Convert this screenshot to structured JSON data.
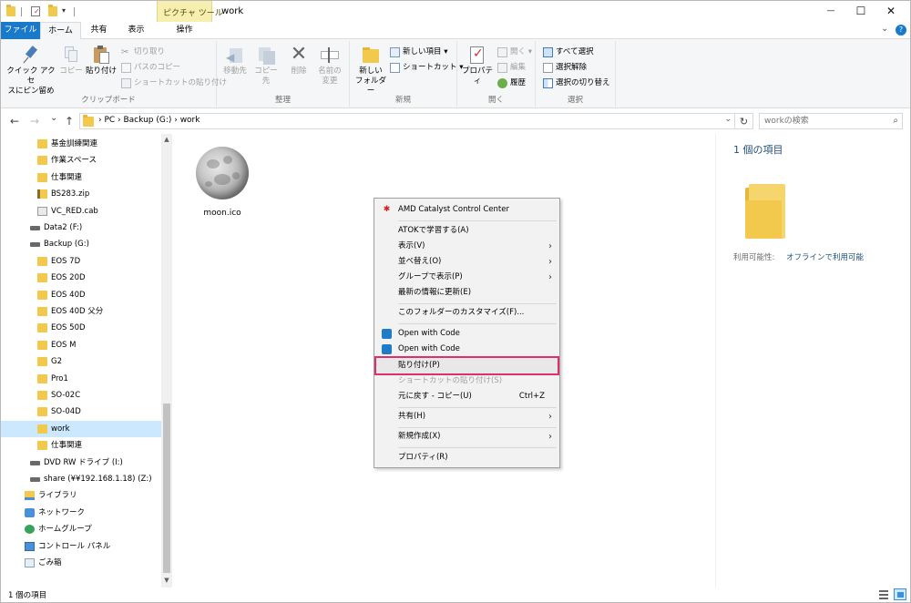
{
  "titlebar": {
    "contextual_tab": "ピクチャ ツール",
    "title": "work",
    "minimize": "—",
    "maximize": "☐",
    "close": "✕"
  },
  "ribbon_tabs": {
    "file": "ファイル",
    "home": "ホーム",
    "share": "共有",
    "view": "表示",
    "manage": "操作",
    "collapse": "⌄",
    "help": "?"
  },
  "ribbon": {
    "clipboard": {
      "label": "クリップボード",
      "pin": "クイック アクセス\nにピン留め",
      "pin_l1": "クイック アクセ",
      "pin_l2": "スにピン留め",
      "copy": "コピー",
      "paste": "貼り付け",
      "cut": "切り取り",
      "copy_path": "パスのコピー",
      "paste_shortcut": "ショートカットの貼り付け"
    },
    "organize": {
      "label": "整理",
      "move_to": "移動先",
      "copy_to": "コピー先",
      "delete": "削除",
      "rename_l1": "名前の",
      "rename_l2": "変更"
    },
    "new": {
      "label": "新規",
      "new_folder_l1": "新しい",
      "new_folder_l2": "フォルダー",
      "new_item": "新しい項目 ▾",
      "shortcut": "ショートカット ▾"
    },
    "open": {
      "label": "開く",
      "properties": "プロパティ",
      "open": "開く ▾",
      "edit": "編集",
      "history": "履歴"
    },
    "select": {
      "label": "選択",
      "select_all": "すべて選択",
      "select_none": "選択解除",
      "invert": "選択の切り替え"
    }
  },
  "address": {
    "back": "←",
    "forward": "→",
    "recent": "⌄",
    "up": "↑",
    "crumb": "›  PC  ›  Backup (G:)  ›  work",
    "refresh": "↻",
    "search_placeholder": "workの検索",
    "search_icon": "⌕"
  },
  "nav": {
    "items": [
      {
        "label": "基金訓練関連",
        "icon": "folder-icon"
      },
      {
        "label": "作業スペース",
        "icon": "folder-icon"
      },
      {
        "label": "仕事関連",
        "icon": "folder-icon"
      },
      {
        "label": "BS283.zip",
        "icon": "zip-icon"
      },
      {
        "label": "VC_RED.cab",
        "icon": "cab-icon"
      },
      {
        "label": "Data2 (F:)",
        "icon": "drive-icon"
      },
      {
        "label": "Backup (G:)",
        "icon": "drive-icon"
      },
      {
        "label": "EOS 7D",
        "icon": "folder-icon"
      },
      {
        "label": "EOS 20D",
        "icon": "folder-icon"
      },
      {
        "label": "EOS 40D",
        "icon": "folder-icon"
      },
      {
        "label": "EOS 40D 父分",
        "icon": "folder-icon"
      },
      {
        "label": "EOS 50D",
        "icon": "folder-icon"
      },
      {
        "label": "EOS M",
        "icon": "folder-icon"
      },
      {
        "label": "G2",
        "icon": "folder-icon"
      },
      {
        "label": "Pro1",
        "icon": "folder-icon"
      },
      {
        "label": "SO-02C",
        "icon": "folder-icon"
      },
      {
        "label": "SO-04D",
        "icon": "folder-icon"
      },
      {
        "label": "work",
        "icon": "folder-icon"
      },
      {
        "label": "仕事関連",
        "icon": "folder-icon"
      },
      {
        "label": "DVD RW ドライブ (I:)",
        "icon": "dvd-drive-icon"
      },
      {
        "label": "share (¥¥192.168.1.18) (Z:)",
        "icon": "network-drive-icon"
      },
      {
        "label": "ライブラリ",
        "icon": "library-icon"
      },
      {
        "label": "ネットワーク",
        "icon": "network-icon"
      },
      {
        "label": "ホームグループ",
        "icon": "homegroup-icon"
      },
      {
        "label": "コントロール パネル",
        "icon": "control-panel-icon"
      },
      {
        "label": "ごみ箱",
        "icon": "recycle-bin-icon"
      }
    ],
    "scroll_up": "▲",
    "scroll_down": "▼"
  },
  "content": {
    "file_name": "moon.ico"
  },
  "details": {
    "count": "1 個の項目",
    "availability_label": "利用可能性:",
    "availability_value": "オフラインで利用可能"
  },
  "status": {
    "text": "1 個の項目"
  },
  "context_menu": {
    "amd": "AMD Catalyst Control Center",
    "atok": "ATOKで学習する(A)",
    "view": "表示(V)",
    "sort": "並べ替え(O)",
    "group": "グループで表示(P)",
    "refresh": "最新の情報に更新(E)",
    "customize": "このフォルダーのカスタマイズ(F)...",
    "open_code_1": "Open with Code",
    "open_code_2": "Open with Code",
    "paste": "貼り付け(P)",
    "paste_shortcut": "ショートカットの貼り付け(S)",
    "undo": "元に戻す - コピー(U)",
    "undo_key": "Ctrl+Z",
    "share": "共有(H)",
    "new": "新規作成(X)",
    "properties": "プロパティ(R)",
    "arrow": "›"
  },
  "colors": {
    "accent": "#1979ca",
    "selection": "#cce8ff",
    "highlight_outline": "#e0306b",
    "folder": "#f2c94c"
  }
}
